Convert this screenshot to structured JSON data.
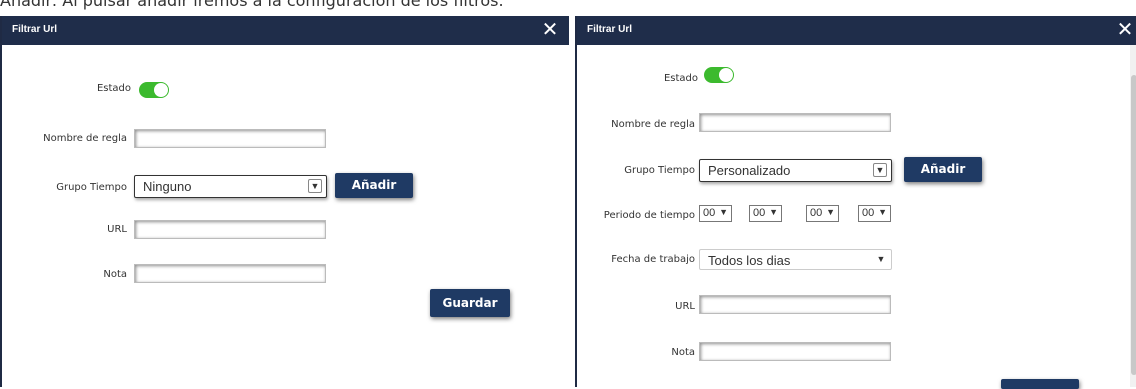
{
  "caption": "Añadir: Al pulsar añadir iremos a la configuración de los filtros.",
  "colors": {
    "header": "#1f2d4a",
    "button": "#1f3a64",
    "toggle_on": "#3cba2e"
  },
  "left": {
    "title": "Filtrar Url",
    "close": "✕",
    "estado_label": "Estado",
    "estado_on": true,
    "nombre_label": "Nombre de regla",
    "nombre_value": "",
    "grupo_label": "Grupo Tiempo",
    "grupo_value": "Ninguno",
    "anadir": "Añadir",
    "url_label": "URL",
    "url_value": "",
    "nota_label": "Nota",
    "nota_value": "",
    "guardar": "Guardar"
  },
  "right": {
    "title": "Filtrar Url",
    "close": "✕",
    "estado_label": "Estado",
    "estado_on": true,
    "nombre_label": "Nombre de regla",
    "nombre_value": "",
    "grupo_label": "Grupo Tiempo",
    "grupo_value": "Personalizado",
    "anadir": "Añadir",
    "periodo_label": "Periodo de tiempo",
    "periodo": [
      "00",
      "00",
      "00",
      "00"
    ],
    "fecha_label": "Fecha de trabajo",
    "fecha_value": "Todos los dias",
    "url_label": "URL",
    "url_value": "",
    "nota_label": "Nota",
    "nota_value": ""
  }
}
